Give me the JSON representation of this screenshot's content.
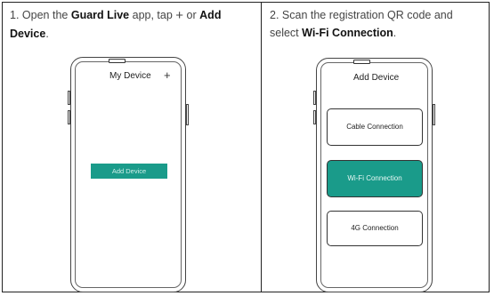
{
  "step1": {
    "number": "1.",
    "text_open": "Open the",
    "app_name": "Guard Live",
    "text_app_tap": "app, tap",
    "plus_glyph": "+",
    "text_or": "or",
    "add_device": "Add Device",
    "period": "."
  },
  "step2": {
    "number": "2.",
    "text_scan": "Scan the registration QR code and select",
    "wifi_connection": "Wi-Fi Connection",
    "period": "."
  },
  "phone1": {
    "title": "My Device",
    "plus_glyph": "+",
    "add_device_button": "Add Device"
  },
  "phone2": {
    "title": "Add Device",
    "options": [
      "Cable Connection",
      "Wi-Fi Connection",
      "4G Connection"
    ]
  },
  "colors": {
    "accent": "#1a9b8a"
  }
}
